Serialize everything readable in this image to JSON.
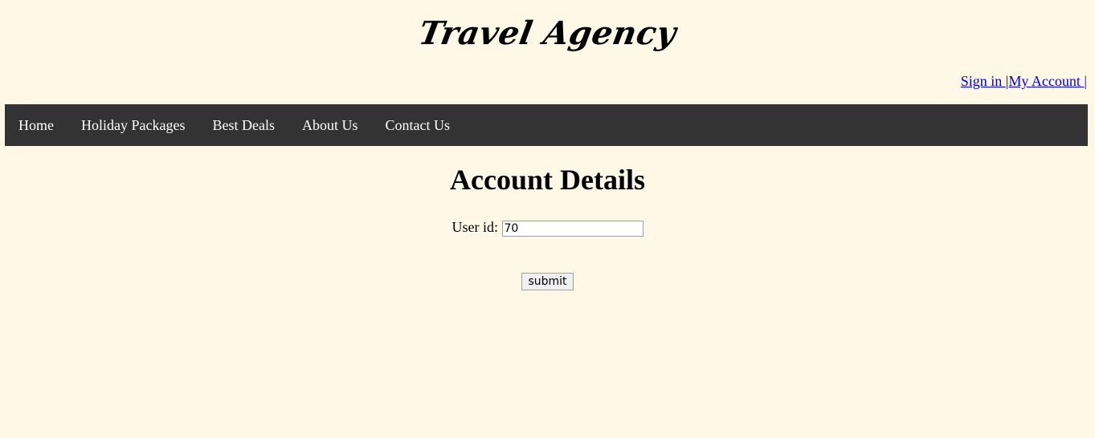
{
  "header": {
    "logo_text": "Travel Agency"
  },
  "account_links": {
    "sign_in": "Sign in ",
    "separator_1": "|",
    "my_account": "My Account ",
    "separator_2": "|"
  },
  "nav": {
    "items": [
      {
        "label": "Home"
      },
      {
        "label": "Holiday Packages"
      },
      {
        "label": "Best Deals"
      },
      {
        "label": "About Us"
      },
      {
        "label": "Contact Us"
      }
    ]
  },
  "main": {
    "title": "Account Details",
    "user_id_label": "User id:",
    "user_id_value": "70",
    "submit_label": "submit"
  },
  "colors": {
    "background": "#fff8e7",
    "nav_background": "#333333",
    "nav_text": "#ffffff",
    "link": "#0000ee"
  }
}
